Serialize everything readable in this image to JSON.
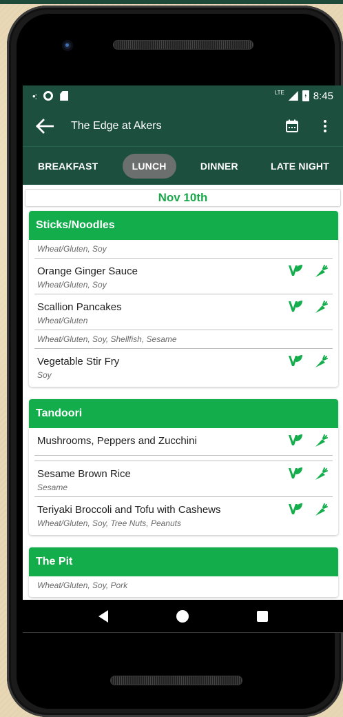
{
  "status_bar": {
    "lte": "LTE",
    "time": "8:45"
  },
  "app_bar": {
    "title": "The Edge at Akers"
  },
  "tabs": [
    {
      "label": "BREAKFAST",
      "active": false
    },
    {
      "label": "LUNCH",
      "active": true
    },
    {
      "label": "DINNER",
      "active": false
    },
    {
      "label": "LATE NIGHT",
      "active": false
    }
  ],
  "date": "Nov 10th",
  "colors": {
    "primary_dark": "#1c4f3d",
    "accent_green": "#13ad4c",
    "date_text": "#1aa84a"
  },
  "sections": [
    {
      "title": "Sticks/Noodles",
      "items": [
        {
          "name": "",
          "allergens": "Wheat/Gluten, Soy",
          "icons": []
        },
        {
          "name": "Orange Ginger Sauce",
          "allergens": "Wheat/Gluten, Soy",
          "icons": [
            "vegetarian-icon",
            "vegan-carrot-icon"
          ]
        },
        {
          "name": "Scallion Pancakes",
          "allergens": "Wheat/Gluten",
          "icons": [
            "vegetarian-icon",
            "vegan-carrot-icon"
          ]
        },
        {
          "name": "",
          "allergens": "Wheat/Gluten, Soy, Shellfish, Sesame",
          "icons": []
        },
        {
          "name": "Vegetable Stir Fry",
          "allergens": "Soy",
          "icons": [
            "vegetarian-icon",
            "vegan-carrot-icon"
          ]
        }
      ]
    },
    {
      "title": "Tandoori",
      "items": [
        {
          "name": "Mushrooms, Peppers and Zucchini",
          "allergens": "",
          "icons": [
            "vegetarian-icon",
            "vegan-carrot-icon"
          ]
        },
        {
          "name": "",
          "allergens": "",
          "icons": []
        },
        {
          "name": "Sesame Brown Rice",
          "allergens": "Sesame",
          "icons": [
            "vegetarian-icon",
            "vegan-carrot-icon"
          ]
        },
        {
          "name": "Teriyaki Broccoli and Tofu with Cashews",
          "allergens": "Wheat/Gluten, Soy, Tree Nuts, Peanuts",
          "icons": [
            "vegetarian-icon",
            "vegan-carrot-icon"
          ]
        }
      ]
    },
    {
      "title": "The Pit",
      "items": [
        {
          "name": "",
          "allergens": "Wheat/Gluten, Soy, Pork",
          "icons": []
        }
      ]
    }
  ]
}
